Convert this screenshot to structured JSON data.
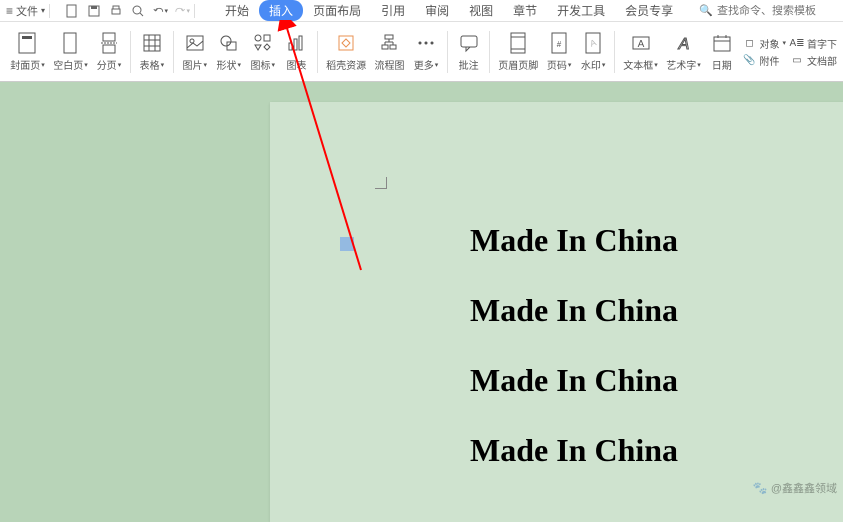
{
  "topbar": {
    "file_label": "文件",
    "qat_icons": [
      "new-doc",
      "save",
      "print",
      "preview",
      "undo",
      "redo"
    ],
    "tabs": [
      "开始",
      "插入",
      "页面布局",
      "引用",
      "审阅",
      "视图",
      "章节",
      "开发工具",
      "会员专享"
    ],
    "active_tab_index": 1,
    "search_placeholder": "查找命令、搜索模板"
  },
  "ribbon": {
    "groups": [
      {
        "icon": "cover",
        "label": "封面页",
        "dd": true
      },
      {
        "icon": "blank",
        "label": "空白页",
        "dd": true
      },
      {
        "icon": "break",
        "label": "分页",
        "dd": true
      }
    ],
    "groups2": [
      {
        "icon": "table",
        "label": "表格",
        "dd": true
      }
    ],
    "groups3": [
      {
        "icon": "picture",
        "label": "图片",
        "dd": true
      },
      {
        "icon": "shape",
        "label": "形状",
        "dd": true
      },
      {
        "icon": "icons",
        "label": "图标",
        "dd": true
      },
      {
        "icon": "chart",
        "label": "图表"
      }
    ],
    "groups4": [
      {
        "icon": "resource",
        "label": "稻壳资源"
      },
      {
        "icon": "flow",
        "label": "流程图"
      },
      {
        "icon": "more",
        "label": "更多",
        "dd": true
      }
    ],
    "groups5": [
      {
        "icon": "comment",
        "label": "批注"
      }
    ],
    "groups6": [
      {
        "icon": "header",
        "label": "页眉页脚"
      },
      {
        "icon": "pagenum",
        "label": "页码",
        "dd": true
      },
      {
        "icon": "watermark",
        "label": "水印",
        "dd": true
      }
    ],
    "groups7": [
      {
        "icon": "textbox",
        "label": "文本框",
        "dd": true
      },
      {
        "icon": "wordart",
        "label": "艺术字",
        "dd": true
      },
      {
        "icon": "date",
        "label": "日期"
      }
    ],
    "right_items": [
      {
        "icon": "object",
        "label": "对象"
      },
      {
        "icon": "attach",
        "label": "附件"
      },
      {
        "icon": "dropcap",
        "label": "首字下"
      },
      {
        "icon": "docpart",
        "label": "文档部"
      }
    ]
  },
  "document": {
    "text_content": "Made In China",
    "line_positions": [
      120,
      190,
      260,
      330
    ]
  },
  "watermark_text": "@鑫鑫鑫领域"
}
